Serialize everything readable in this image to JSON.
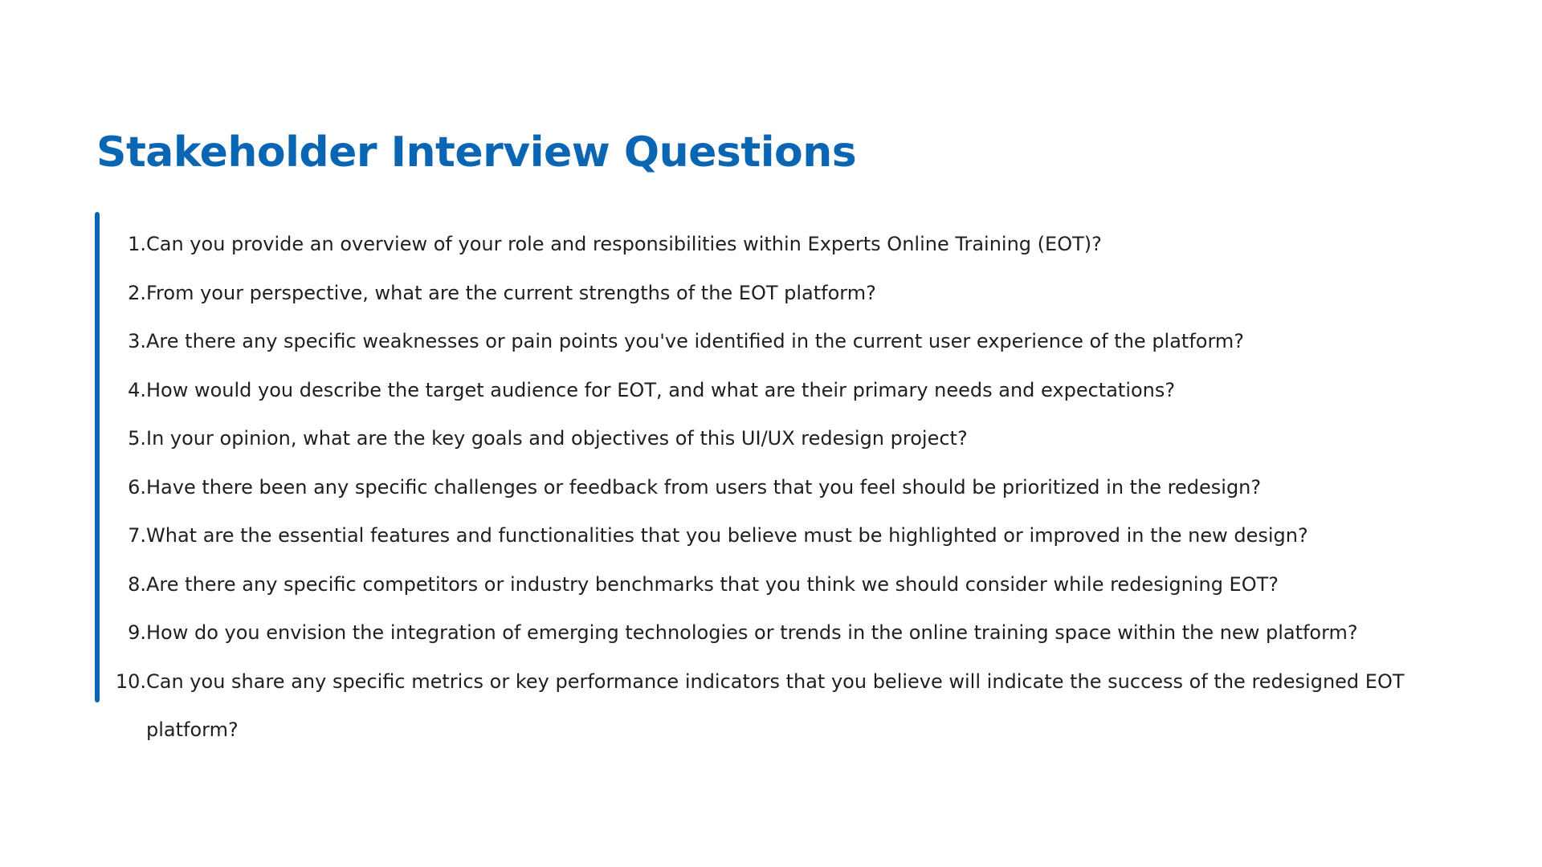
{
  "page": {
    "title": "Stakeholder Interview Questions",
    "colors": {
      "accent": "#0a66b3",
      "text": "#1f1f1f",
      "background": "#ffffff"
    }
  },
  "questions": [
    {
      "number": "1.",
      "text": "Can you provide an overview of your role and responsibilities within Experts Online Training (EOT)?"
    },
    {
      "number": "2.",
      "text": "From your perspective, what are the current strengths of the EOT platform?"
    },
    {
      "number": "3.",
      "text": "Are there any specific weaknesses or pain points you've identified in the current user experience of the platform?"
    },
    {
      "number": "4.",
      "text": "How would you describe the target audience for EOT, and what are their primary needs and expectations?"
    },
    {
      "number": "5.",
      "text": "In your opinion, what are the key goals and objectives of this UI/UX redesign project?"
    },
    {
      "number": "6.",
      "text": "Have there been any specific challenges or feedback from users that you feel should be prioritized in the redesign?"
    },
    {
      "number": "7.",
      "text": "What are the essential features and functionalities that you believe must be highlighted or improved in the new design?"
    },
    {
      "number": "8.",
      "text": "Are there any specific competitors or industry benchmarks that you think we should consider while redesigning EOT?"
    },
    {
      "number": "9.",
      "text": "How do you envision the integration of emerging technologies or trends in the online training space within the new platform?"
    },
    {
      "number": "10.",
      "text": "Can you share any specific metrics or key performance indicators that you believe will indicate the success of the redesigned EOT platform?"
    }
  ]
}
